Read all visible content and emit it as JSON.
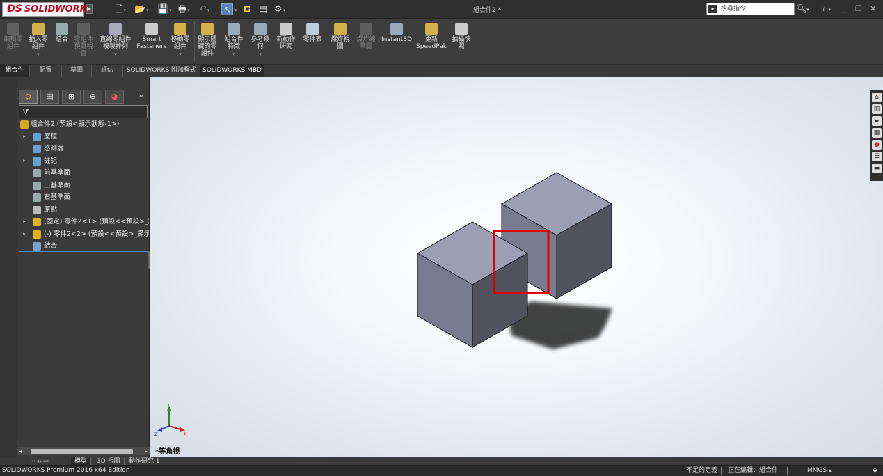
{
  "app": {
    "brand": "SOLIDWORKS",
    "document_title": "組合件2 *"
  },
  "quick_access": [
    "new-icon",
    "open-icon",
    "save-icon",
    "print-icon",
    "undo-icon",
    "select-icon",
    "rebuild-icon",
    "file-properties-icon",
    "options-icon"
  ],
  "search": {
    "placeholder": "搜尋指令"
  },
  "commands": [
    {
      "label": "編輯零\n組件",
      "enabled": false,
      "icon": "edit-component-icon",
      "color": "#8a8a8a"
    },
    {
      "label": "插入零\n組件",
      "enabled": true,
      "icon": "insert-components-icon",
      "color": "#d4b04a",
      "dropdown": true
    },
    {
      "label": "結合",
      "enabled": true,
      "icon": "mate-icon",
      "color": "#9aa"
    },
    {
      "label": "零組件\n預覽視\n窗",
      "enabled": false,
      "icon": "component-preview-icon",
      "color": "#888"
    },
    {
      "label": "直線零組件\n複製排列",
      "enabled": true,
      "icon": "linear-pattern-icon",
      "color": "#aab",
      "dropdown": true
    },
    {
      "label": "Smart\nFasteners",
      "enabled": true,
      "icon": "smart-fasteners-icon",
      "color": "#ccc"
    },
    {
      "label": "移動零\n組件",
      "enabled": true,
      "icon": "move-component-icon",
      "color": "#d4b04a",
      "dropdown": true
    },
    {
      "label": "顯示隱\n藏的零\n組件",
      "enabled": true,
      "icon": "show-hidden-icon",
      "color": "#d4b04a"
    },
    {
      "label": "組合件\n特徵",
      "enabled": true,
      "icon": "assembly-features-icon",
      "color": "#9ab",
      "dropdown": true
    },
    {
      "label": "參考幾\n何",
      "enabled": true,
      "icon": "reference-geometry-icon",
      "color": "#9ab",
      "dropdown": true
    },
    {
      "label": "新動作\n研究",
      "enabled": true,
      "icon": "motion-study-icon",
      "color": "#ccc"
    },
    {
      "label": "零件表",
      "enabled": true,
      "icon": "bom-icon",
      "color": "#bcd"
    },
    {
      "label": "爆炸視\n圖",
      "enabled": true,
      "icon": "exploded-view-icon",
      "color": "#d4b04a"
    },
    {
      "label": "爆炸線\n草圖",
      "enabled": false,
      "icon": "explode-line-sketch-icon",
      "color": "#888"
    },
    {
      "label": "Instant3D",
      "enabled": true,
      "icon": "instant3d-icon",
      "color": "#9ab"
    },
    {
      "label": "更新\nSpeedPak",
      "enabled": true,
      "icon": "speedpak-icon",
      "color": "#d4b04a"
    },
    {
      "label": "拍攝快\n照",
      "enabled": true,
      "icon": "snapshot-icon",
      "color": "#ccc"
    }
  ],
  "tabs": [
    "組合件",
    "配置",
    "草圖",
    "評估",
    "SOLIDWORKS 附加程式",
    "SOLIDWORKS MBD"
  ],
  "tree": [
    {
      "label": "組合件2 (預設<顯示狀態-1>)",
      "icon": "assembly-icon",
      "color": "#d4a820",
      "indent": 0,
      "expand": ""
    },
    {
      "label": "歷程",
      "icon": "history-icon",
      "color": "#6a9fd4",
      "indent": 1,
      "expand": "▸"
    },
    {
      "label": "感測器",
      "icon": "sensors-icon",
      "color": "#6a9fd4",
      "indent": 1,
      "expand": ""
    },
    {
      "label": "註記",
      "icon": "annotations-icon",
      "color": "#6a9fd4",
      "indent": 1,
      "expand": "▸"
    },
    {
      "label": "前基準面",
      "icon": "plane-icon",
      "color": "#9aa",
      "indent": 1,
      "expand": ""
    },
    {
      "label": "上基準面",
      "icon": "plane-icon",
      "color": "#9aa",
      "indent": 1,
      "expand": ""
    },
    {
      "label": "右基準面",
      "icon": "plane-icon",
      "color": "#9aa",
      "indent": 1,
      "expand": ""
    },
    {
      "label": "原點",
      "icon": "origin-icon",
      "color": "#bbb",
      "indent": 1,
      "expand": ""
    },
    {
      "label": "(固定) 零件2<1> (預設<<預設>_顯",
      "icon": "part-icon",
      "color": "#e0b020",
      "indent": 1,
      "expand": "▸"
    },
    {
      "label": "(-) 零件2<2> (預設<<預設>_顯示狀",
      "icon": "part-icon",
      "color": "#e0b020",
      "indent": 1,
      "expand": "▸"
    },
    {
      "label": "結合",
      "icon": "mates-icon",
      "color": "#7aa0c8",
      "indent": 1,
      "expand": ""
    }
  ],
  "view": {
    "name": "*等角視",
    "triad": {
      "y": "Y",
      "x": "X",
      "z": "Z"
    }
  },
  "bottom_tabs": [
    "模型",
    "3D 視圖",
    "動作研究 1"
  ],
  "status": {
    "left": "SOLIDWORKS Premium 2016 x64 Edition",
    "definition": "不足的定義",
    "editing": "正在編輯：組合件",
    "units": "MMGS"
  },
  "colors": {
    "cube_top": "#9c9eb4",
    "cube_front": "#787a90",
    "cube_side": "#52535f",
    "highlight": "#e00000"
  }
}
